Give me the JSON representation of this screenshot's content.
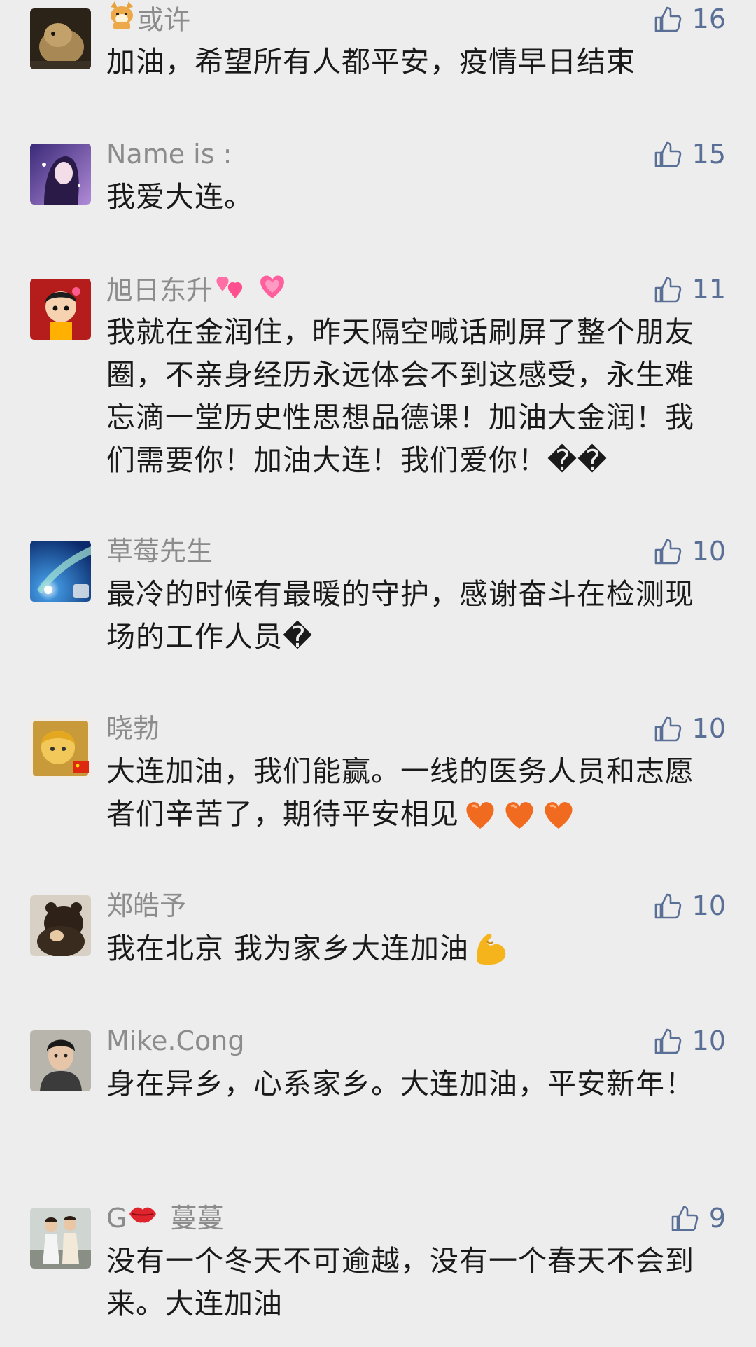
{
  "comments": [
    {
      "name": "或许",
      "likes": "16",
      "text": "加油，希望所有人都平安，疫情早日结束",
      "avatar": "bear-photo",
      "name_prefix_icon": "shiba-dog-icon"
    },
    {
      "name": "Name is :",
      "likes": "15",
      "text": "我爱大连。",
      "avatar": "anime-girl"
    },
    {
      "name": "旭日东升",
      "likes": "11",
      "text": "我就在金润住，昨天隔空喊话刷屏了整个朋友圈，不亲身经历永远体会不到这感受，永生难忘滴一堂历史性思想品德课！加油大金润！我们需要你！加油大连！我们爱你！",
      "avatar": "cartoon-baby",
      "name_suffix_icons": [
        "two-hearts-icon",
        "growing-heart-icon"
      ],
      "text_suffix": "��"
    },
    {
      "name": "草莓先生",
      "likes": "10",
      "text": "最冷的时候有最暖的守护，感谢奋斗在检测现场的工作人员",
      "avatar": "aurora-sky",
      "text_suffix": "�"
    },
    {
      "name": "晓勃",
      "likes": "10",
      "text": "大连加油，我们能赢。一线的医务人员和志愿者们辛苦了，期待平安相见",
      "avatar": "cartoon-face-flag",
      "text_emojis": [
        "orange-heart-icon",
        "orange-heart-icon",
        "orange-heart-icon"
      ]
    },
    {
      "name": "郑皓予",
      "likes": "10",
      "text": "我在北京 我为家乡大连加油",
      "avatar": "plush-bear",
      "text_emojis": [
        "flexed-biceps-icon"
      ]
    },
    {
      "name": "Mike.Cong",
      "likes": "10",
      "text": "身在异乡，心系家乡。大连加油，平安新年！",
      "avatar": "young-man"
    },
    {
      "name_prefix": "G",
      "name": "蔓蔓",
      "likes": "9",
      "text": "没有一个冬天不可逾越，没有一个春天不会到来。大连加油",
      "avatar": "couple-photo",
      "name_middle_icon": "kiss-lips-icon"
    }
  ]
}
